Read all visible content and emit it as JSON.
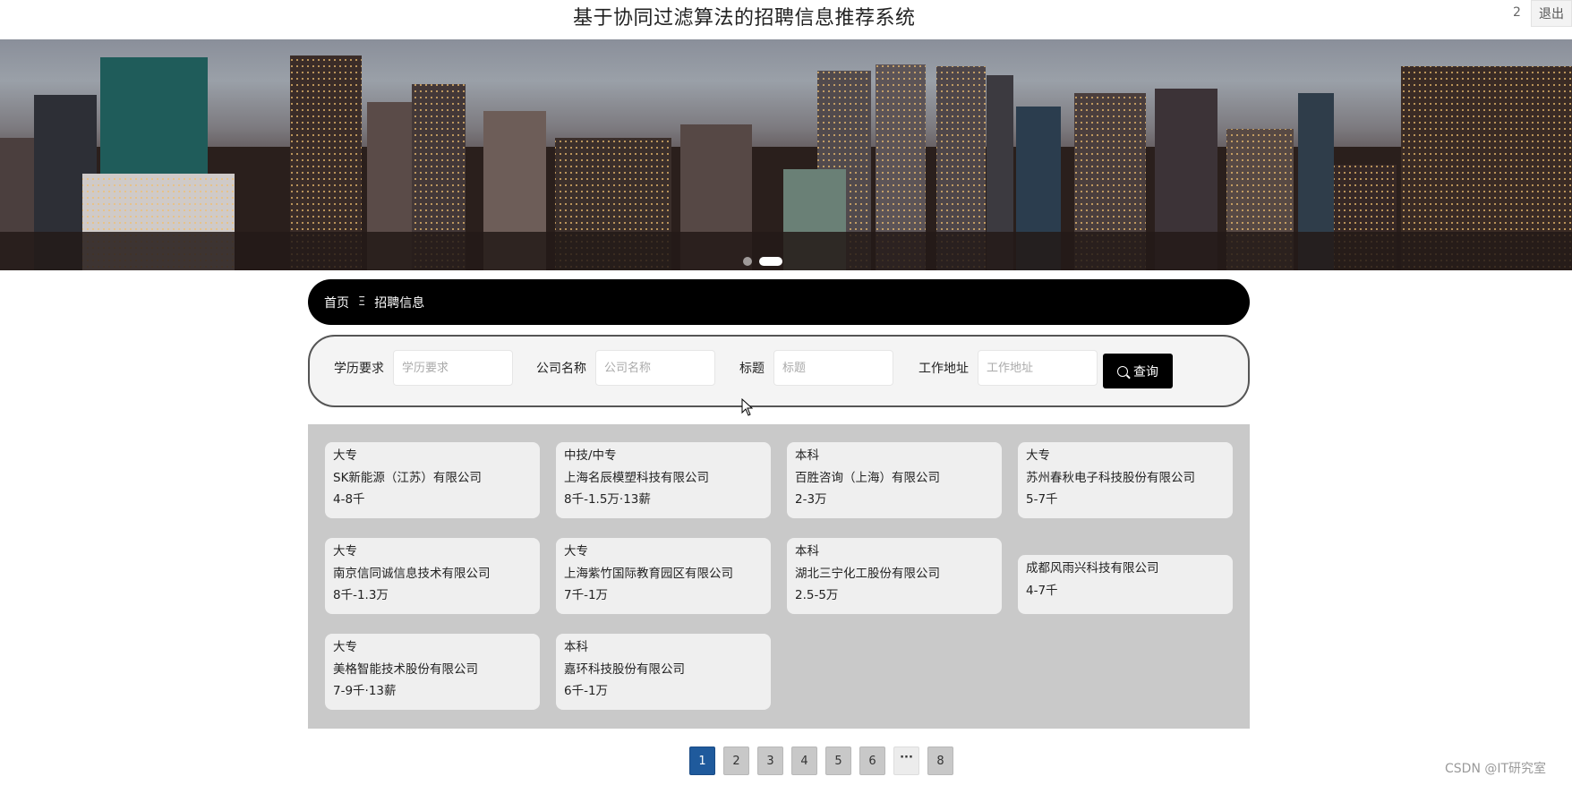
{
  "header": {
    "title": "基于协同过滤算法的招聘信息推荐系统",
    "user_id": "2",
    "logout_label": "退出"
  },
  "breadcrumb": {
    "home": "首页",
    "separator": "Ξ",
    "current": "招聘信息"
  },
  "search": {
    "fields": [
      {
        "label": "学历要求",
        "placeholder": "学历要求"
      },
      {
        "label": "公司名称",
        "placeholder": "公司名称"
      },
      {
        "label": "标题",
        "placeholder": "标题"
      },
      {
        "label": "工作地址",
        "placeholder": "工作地址"
      }
    ],
    "button_label": "查询"
  },
  "jobs": [
    {
      "education": "大专",
      "company": "SK新能源（江苏）有限公司",
      "salary": "4-8千"
    },
    {
      "education": "中技/中专",
      "company": "上海名辰模塑科技有限公司",
      "salary": "8千-1.5万·13薪"
    },
    {
      "education": "本科",
      "company": "百胜咨询（上海）有限公司",
      "salary": "2-3万"
    },
    {
      "education": "大专",
      "company": "苏州春秋电子科技股份有限公司",
      "salary": "5-7千"
    },
    {
      "education": "大专",
      "company": "南京信同诚信息技术有限公司",
      "salary": "8千-1.3万"
    },
    {
      "education": "大专",
      "company": "上海紫竹国际教育园区有限公司",
      "salary": "7千-1万"
    },
    {
      "education": "本科",
      "company": "湖北三宁化工股份有限公司",
      "salary": "2.5-5万"
    },
    {
      "education": "",
      "company": "成都风雨兴科技有限公司",
      "salary": "4-7千"
    },
    {
      "education": "大专",
      "company": "美格智能技术股份有限公司",
      "salary": "7-9千·13薪"
    },
    {
      "education": "本科",
      "company": "嘉环科技股份有限公司",
      "salary": "6千-1万"
    }
  ],
  "pagination": {
    "pages": [
      "1",
      "2",
      "3",
      "4",
      "5",
      "6",
      "···",
      "8"
    ],
    "current": "1"
  },
  "watermark": "CSDN @IT研究室"
}
